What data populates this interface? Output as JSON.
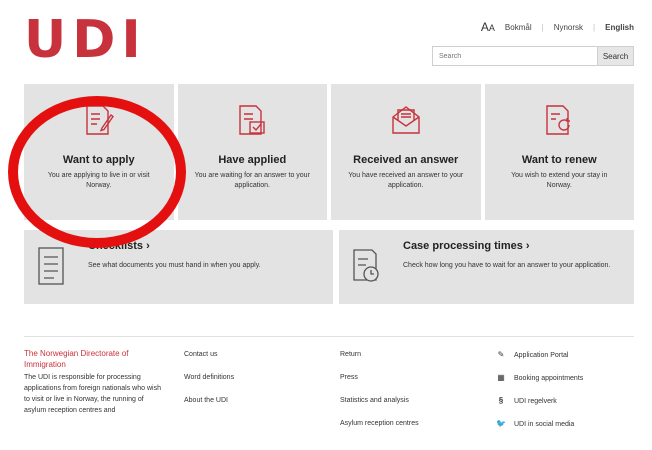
{
  "header": {
    "logo": "UDI",
    "text_size_icon": "AA",
    "languages": [
      "Bokmål",
      "Nynorsk",
      "English"
    ],
    "active_language": "English",
    "search_placeholder": "Search",
    "search_button": "Search"
  },
  "tiles": [
    {
      "title": "Want to apply",
      "subtitle": "You are applying to live in or visit Norway.",
      "icon": "document-pen-icon"
    },
    {
      "title": "Have applied",
      "subtitle": "You are waiting for an answer to your application.",
      "icon": "document-check-icon"
    },
    {
      "title": "Received an answer",
      "subtitle": "You have received an answer to your application.",
      "icon": "envelope-icon"
    },
    {
      "title": "Want to renew",
      "subtitle": "You wish to extend your stay in Norway.",
      "icon": "document-refresh-icon"
    }
  ],
  "wide_tiles": [
    {
      "title": "Checklists ›",
      "subtitle": "See what documents you must hand in when you apply.",
      "icon": "checklist-icon"
    },
    {
      "title": "Case processing times ›",
      "subtitle": "Check how long you have to wait for an answer to your application.",
      "icon": "clock-document-icon"
    }
  ],
  "footer": {
    "about_title": "The Norwegian Directorate of Immigration",
    "about_text": "The UDI is responsible for processing applications from foreign nationals who wish to visit or live in Norway, the running of asylum reception centres and",
    "col1": [
      "Contact us",
      "Word definitions",
      "About the UDI"
    ],
    "col2": [
      "Return",
      "Press",
      "Statistics and analysis",
      "Asylum reception centres"
    ],
    "col3": [
      {
        "label": "Application Portal",
        "icon": "edit-icon"
      },
      {
        "label": "Booking appointments",
        "icon": "calendar-icon"
      },
      {
        "label": "UDI regelverk",
        "icon": "paragraph-icon"
      },
      {
        "label": "UDI in social media",
        "icon": "twitter-icon"
      }
    ]
  },
  "colors": {
    "brand": "#c8323c",
    "tile_bg": "#e3e3e3",
    "highlight_circle": "#e41010"
  }
}
